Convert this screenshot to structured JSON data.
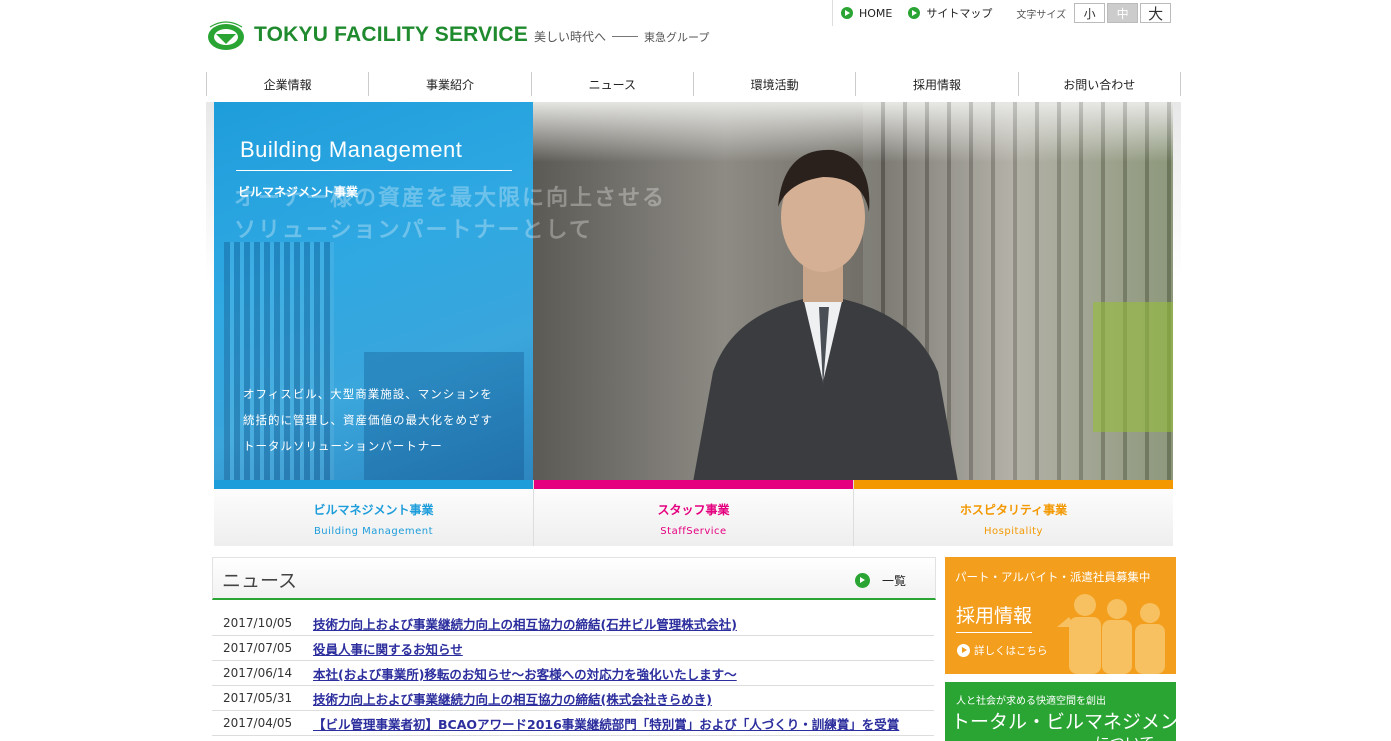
{
  "brand": {
    "name": "TOKYU FACILITY SERVICE",
    "tagline": "美しい時代へ",
    "group": "東急グループ"
  },
  "toplinks": {
    "home": "HOME",
    "sitemap": "サイトマップ",
    "fontsize_label": "文字サイズ",
    "small": "小",
    "medium": "中",
    "large": "大"
  },
  "nav": [
    "企業情報",
    "事業紹介",
    "ニュース",
    "環境活動",
    "採用情報",
    "お問い合わせ"
  ],
  "hero": {
    "title": "Building Management",
    "subtitle": "ビルマネジメント事業",
    "catch_line1": "オーナー様の資産を最大限に向上させる",
    "catch_line2": "ソリューションパートナーとして",
    "desc1": "オフィスビル、大型商業施設、マンションを",
    "desc2": "統括的に管理し、資産価値の最大化をめざす",
    "desc3": "トータルソリューションパートナー"
  },
  "tabs": [
    {
      "jp": "ビルマネジメント事業",
      "en": "Building Management",
      "color": "#1e9ddb"
    },
    {
      "jp": "スタッフ事業",
      "en": "StaffService",
      "color": "#e5007f"
    },
    {
      "jp": "ホスピタリティ事業",
      "en": "Hospitality",
      "color": "#f39800"
    }
  ],
  "news": {
    "title": "ニュース",
    "all_link": "一覧",
    "items": [
      {
        "date": "2017/10/05",
        "title": "技術力向上および事業継続力向上の相互協力の締結(石井ビル管理株式会社)"
      },
      {
        "date": "2017/07/05",
        "title": "役員人事に関するお知らせ"
      },
      {
        "date": "2017/06/14",
        "title": "本社(および事業所)移転のお知らせ～お客様への対応力を強化いたします～"
      },
      {
        "date": "2017/05/31",
        "title": "技術力向上および事業継続力向上の相互協力の締結(株式会社きらめき)"
      },
      {
        "date": "2017/04/05",
        "title": "【ビル管理事業者初】BCAOアワード2016事業継続部門「特別賞」および「人づくり・訓練賞」を受賞"
      }
    ]
  },
  "banner_recruit": {
    "top": "パート・アルバイト・派遣社員募集中",
    "title": "採用情報",
    "more": "詳しくはこちら",
    "color": "#f39e1c"
  },
  "banner_tbm": {
    "top": "人と社会が求める快適空間を創出",
    "title": "トータル・ビルマネジメント",
    "sub": "について",
    "color": "#2aa534"
  }
}
